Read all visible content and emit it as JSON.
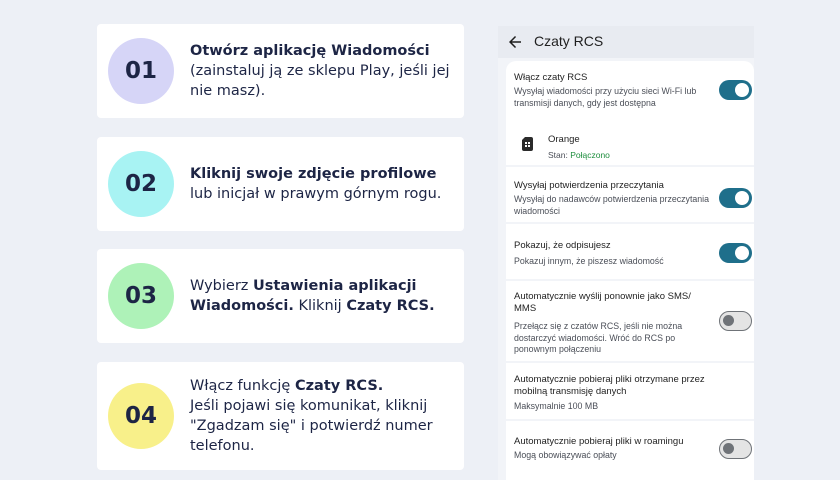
{
  "steps": [
    {
      "number": "01",
      "color": "#d6d5f7",
      "bold1": "Otwórz aplikację Wiadomości",
      "text1": " (zainstaluj ją ze sklepu Play, jeśli jej nie masz)."
    },
    {
      "number": "02",
      "color": "#a8f3f3",
      "bold1": "Kliknij swoje zdjęcie profilowe",
      "text1": " lub inicjał w prawym górnym rogu."
    },
    {
      "number": "03",
      "color": "#aef2b8",
      "text0": "Wybierz ",
      "bold1": "Ustawienia aplikacji Wiadomości.",
      "text1": " Kliknij ",
      "bold2": "Czaty RCS."
    },
    {
      "number": "04",
      "color": "#f8f08a",
      "text0": "Włącz funkcję ",
      "bold1": "Czaty RCS.",
      "text1": "Jeśli pojawi się komunikat, kliknij \"Zgadzam się\" i potwierdź numer telefonu."
    }
  ],
  "phone": {
    "title": "Czaty RCS",
    "enable_rcs": {
      "title": "Włącz czaty RCS",
      "subtitle": "Wysyłaj wiadomości przy użyciu sieci Wi-Fi lub transmisji danych, gdy jest dostępna",
      "on": true
    },
    "sim": {
      "name": "Orange",
      "status_label": "Stan: ",
      "status_value": "Połączono"
    },
    "read_receipts": {
      "title": "Wysyłaj potwierdzenia przeczytania",
      "subtitle": "Wysyłaj do nadawców potwierdzenia przeczytania wiadomości",
      "on": true
    },
    "typing": {
      "title": "Pokazuj, że odpisujesz",
      "subtitle": "Pokazuj innym, że piszesz wiadomość",
      "on": true
    },
    "resend_sms": {
      "title": "Automatycznie wyślij ponownie jako SMS/ MMS",
      "subtitle": "Przełącz się z czatów RCS, jeśli nie można dostarczyć wiadomości. Wróć do RCS po ponownym połączeniu",
      "on": false
    },
    "auto_download": {
      "title": "Automatycznie pobieraj pliki otrzymane przez mobilną transmisję danych",
      "subtitle": "Maksymalnie 100 MB"
    },
    "roaming": {
      "title": "Automatycznie pobieraj pliki w roamingu",
      "subtitle": "Mogą obowiązywać opłaty",
      "on": false
    }
  }
}
